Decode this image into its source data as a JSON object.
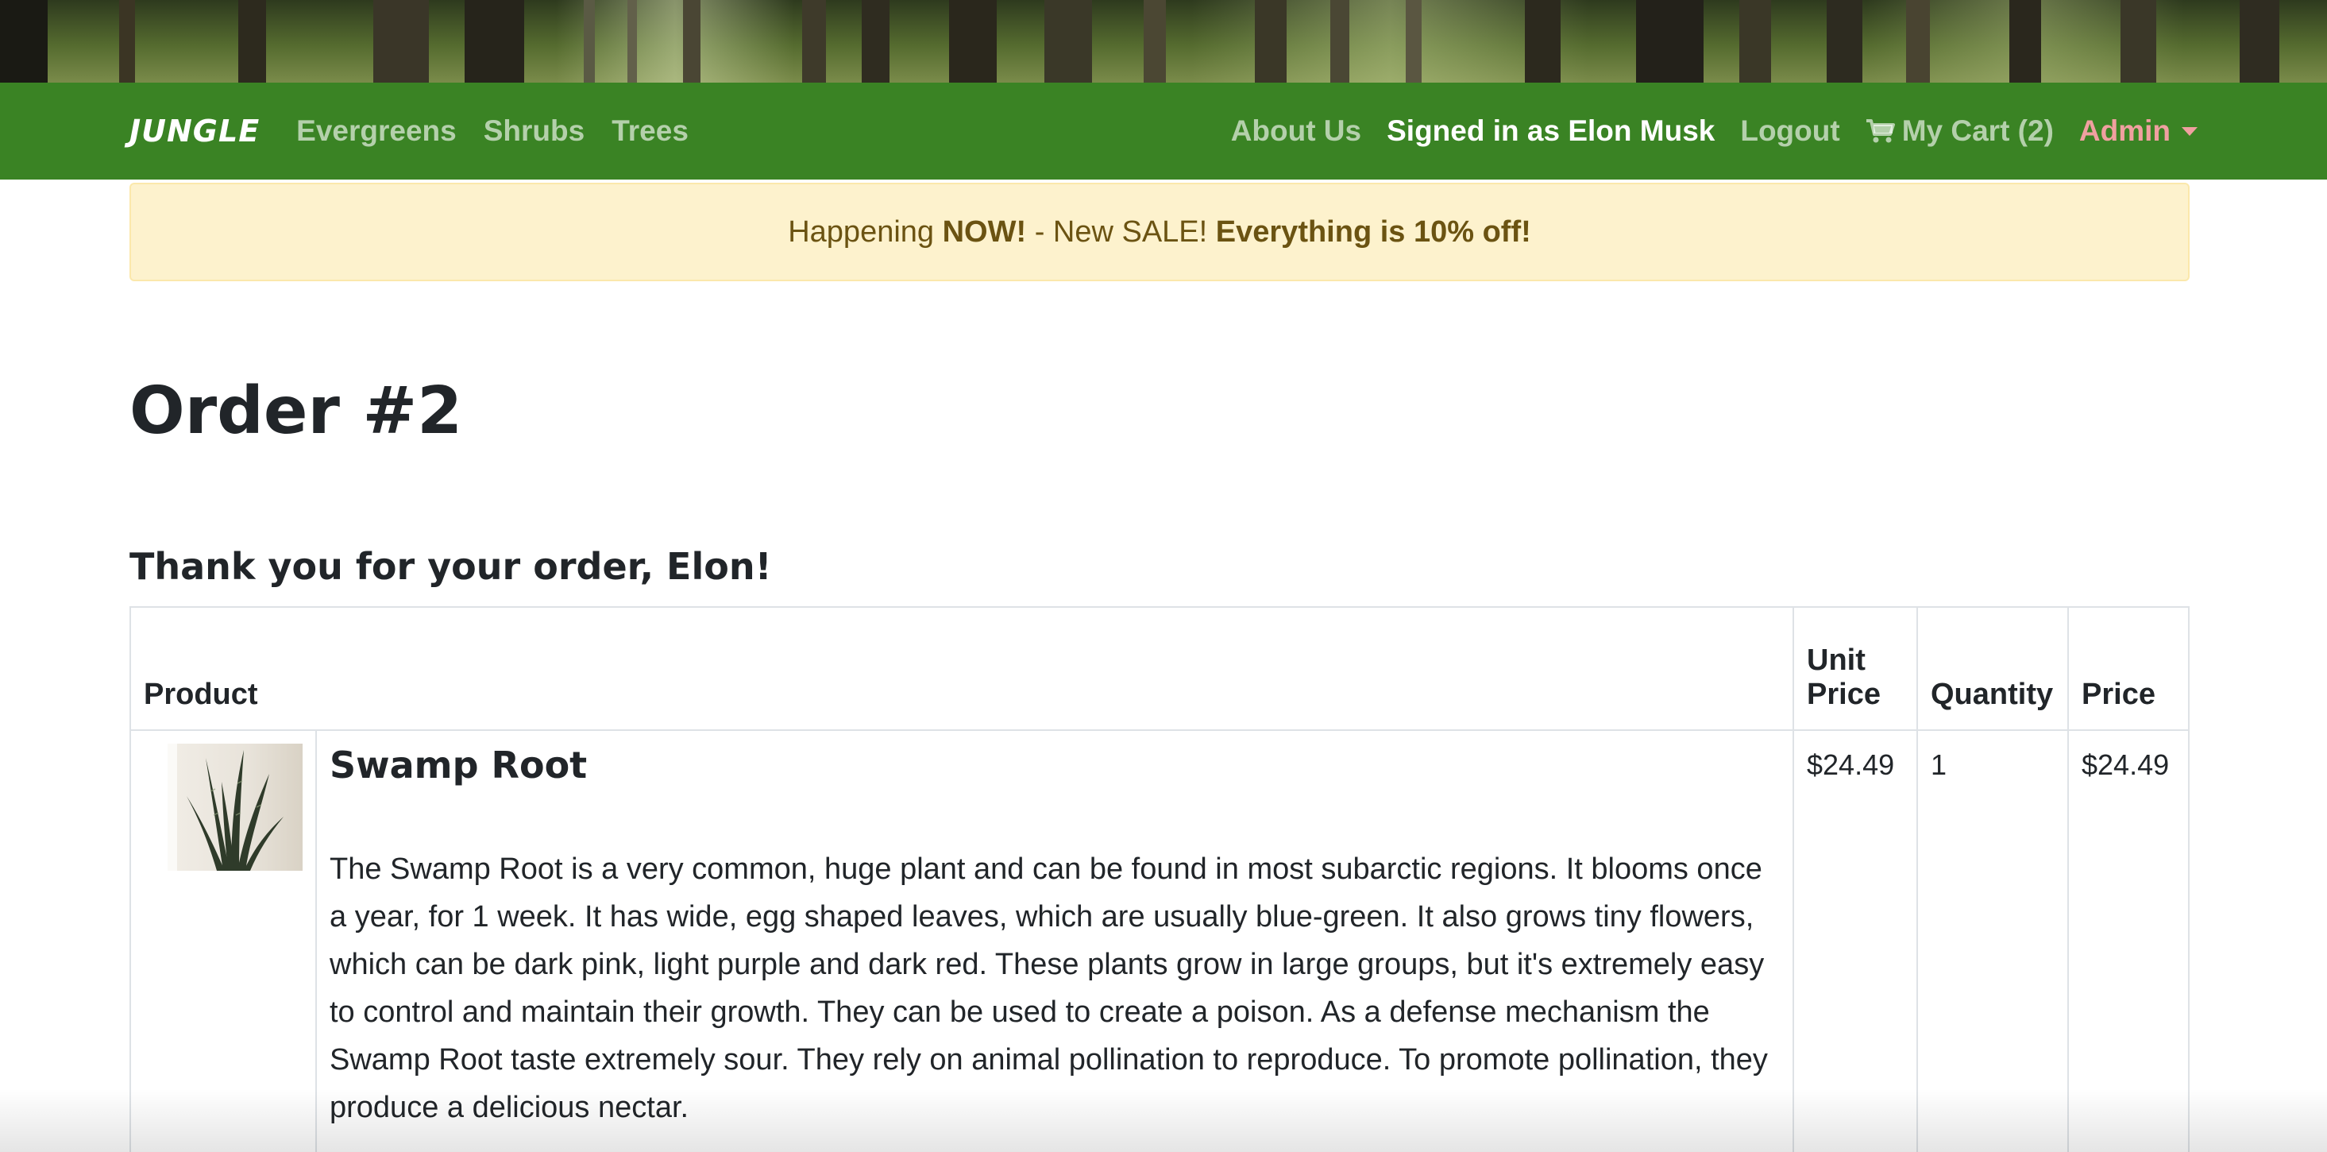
{
  "navbar": {
    "brand": "JUNGLE",
    "links": [
      "Evergreens",
      "Shrubs",
      "Trees"
    ],
    "about": "About Us",
    "signed_in": "Signed in as Elon Musk",
    "logout": "Logout",
    "cart": "My Cart (2)",
    "admin": "Admin",
    "colors": {
      "bar": "#3a8324",
      "admin": "#f0a0a0"
    }
  },
  "alert": {
    "prefix": "Happening ",
    "now": "NOW!",
    "middle": " - New SALE! ",
    "bold": "Everything is 10% off!"
  },
  "page": {
    "title": "Order #2",
    "thanks": "Thank you for your order, Elon!"
  },
  "table": {
    "headers": {
      "product": "Product",
      "unit_price_1": "Unit",
      "unit_price_2": "Price",
      "quantity": "Quantity",
      "price": "Price"
    },
    "rows": [
      {
        "name": "Swamp Root",
        "description": "The Swamp Root is a very common, huge plant and can be found in most subarctic regions. It blooms once a year, for 1 week. It has wide, egg shaped leaves, which are usually blue-green. It also grows tiny flowers, which can be dark pink, light purple and dark red. These plants grow in large groups, but it's extremely easy to control and maintain their growth. They can be used to create a poison. As a defense mechanism the Swamp Root taste extremely sour. They rely on animal pollination to reproduce. To promote pollination, they produce a delicious nectar.",
        "unit_price": "$24.49",
        "quantity": "1",
        "price": "$24.49",
        "image_icon": "snake-plant-photo"
      }
    ]
  }
}
